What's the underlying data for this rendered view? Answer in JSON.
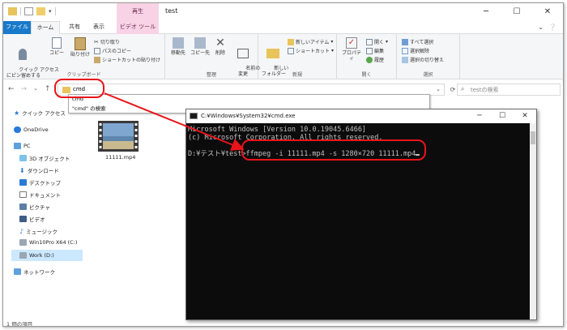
{
  "window": {
    "title": "test",
    "video_tab_header": "再生"
  },
  "tabs": {
    "file": "ファイル",
    "home": "ホーム",
    "share": "共有",
    "view": "表示",
    "video_tools": "ビデオ ツール"
  },
  "ribbon": {
    "clipboard": {
      "group_label": "クリップボード",
      "pin": "クイック アクセス\nにピン留めする",
      "copy": "コピー",
      "paste": "貼り付け",
      "cut": "切り取り",
      "copy_path": "パスのコピー",
      "paste_shortcut": "ショートカットの貼り付け"
    },
    "organize": {
      "group_label": "整理",
      "move_to": "移動先",
      "copy_to": "コピー先",
      "delete": "削除",
      "rename": "名前の\n変更"
    },
    "new": {
      "group_label": "新規",
      "new_folder": "新しい\nフォルダー",
      "new_item": "新しいアイテム",
      "shortcut": "ショートカット"
    },
    "open": {
      "group_label": "開く",
      "properties": "プロパティ",
      "open": "開く",
      "edit": "編集",
      "history": "履歴"
    },
    "select": {
      "group_label": "選択",
      "select_all": "すべて選択",
      "select_none": "選択解除",
      "invert": "選択の切り替え"
    }
  },
  "address": {
    "value": "cmd",
    "search_placeholder": "testの検索"
  },
  "autocomplete": {
    "items": [
      "cmd",
      "\"cmd\" の検索"
    ]
  },
  "nav": {
    "quick_access": "クイック アクセス",
    "onedrive": "OneDrive",
    "pc": "PC",
    "objects3d": "3D オブジェクト",
    "downloads": "ダウンロード",
    "desktop": "デスクトップ",
    "documents": "ドキュメント",
    "pictures": "ピクチャ",
    "videos": "ビデオ",
    "music": "ミュージック",
    "drive_c": "Win10Pro X64 (C:)",
    "drive_d": "Work (D:)",
    "network": "ネットワーク"
  },
  "files": [
    {
      "name": "11111.mp4"
    }
  ],
  "status": {
    "items": "1 個の項目"
  },
  "cmd": {
    "title": "C:¥Windows¥System32¥cmd.exe",
    "lines": [
      "Microsoft Windows [Version 10.0.19045.6466]",
      "(c) Microsoft Corporation. All rights reserved.",
      "",
      "D:¥テスト¥test>ffmpeg -i 11111.mp4 -s 1280×720 11111.mp4"
    ]
  }
}
